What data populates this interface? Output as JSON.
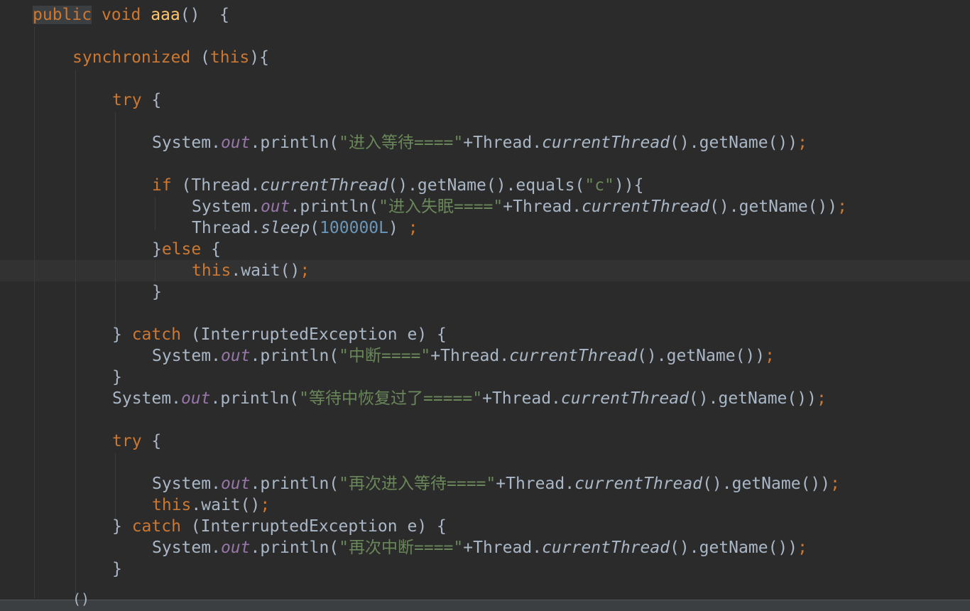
{
  "editor": {
    "language": "java",
    "colors": {
      "background": "#2b2b2b",
      "keyword": "#cc7832",
      "method_decl": "#ffc66d",
      "string": "#6a8759",
      "number": "#6897bb",
      "field": "#9876aa",
      "default": "#a9b7c6"
    },
    "tokens": {
      "public": "public",
      "void": "void",
      "method_name": "aaa",
      "synchronized": "synchronized",
      "this": "this",
      "try": "try",
      "if": "if",
      "else": "else",
      "catch": "catch",
      "system": "System",
      "out": "out",
      "println": "println",
      "thread": "Thread",
      "current_thread": "currentThread",
      "get_name": "getName",
      "equals": "equals",
      "sleep": "sleep",
      "wait": "wait",
      "interrupted_exception": "InterruptedException",
      "var_e": "e"
    },
    "strings": {
      "s1": "\"进入等待====\"",
      "s2": "\"c\"",
      "s3": "\"进入失眠====\"",
      "s4": "\"中断====\"",
      "s5": "\"等待中恢复过了=====\"",
      "s6": "\"再次进入等待====\"",
      "s7": "\"再次中断====\""
    },
    "numbers": {
      "sleep_ms": "100000L"
    },
    "footer_text": "()"
  }
}
